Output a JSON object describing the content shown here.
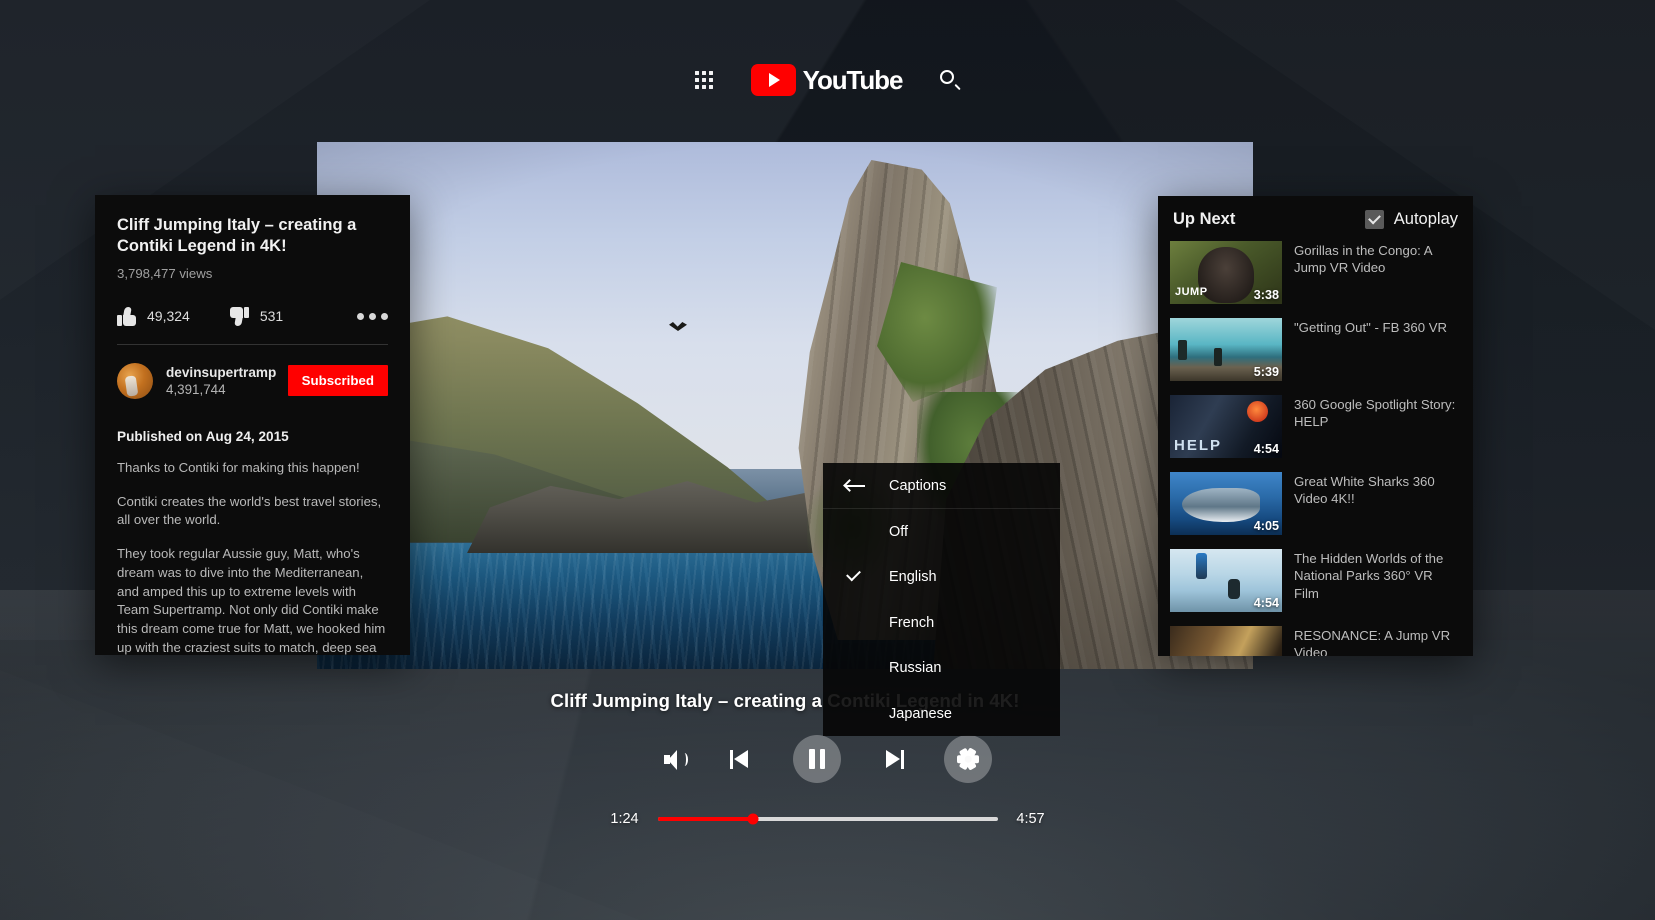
{
  "header": {
    "apps_icon": "apps-grid-icon",
    "logo_text": "YouTube",
    "search_icon": "search-icon"
  },
  "video": {
    "overlay_title": "Cliff Jumping Italy – creating a Contiki Legend in 4K!"
  },
  "info_panel": {
    "title": "Cliff Jumping Italy – creating a Contiki Legend in 4K!",
    "views": "3,798,477 views",
    "likes": "49,324",
    "dislikes": "531",
    "more_icon": "more-options-icon",
    "channel_name": "devinsupertramp",
    "channel_subs": "4,391,744",
    "subscribe_label": "Subscribed",
    "published": "Published on Aug 24, 2015",
    "description": [
      "Thanks to Contiki for making this happen!",
      "Contiki creates the world's best travel stories, all over the world.",
      "They took regular Aussie guy, Matt, who's dream was to dive into the Mediterranean, and amped this up to extreme levels with Team Supertramp. Not only did Contiki make this dream come true for Matt, we hooked him up with the craziest suits to match, deep sea base"
    ]
  },
  "up_next": {
    "heading": "Up Next",
    "autoplay_label": "Autoplay",
    "autoplay_checked": true,
    "items": [
      {
        "title": "Gorillas in the Congo: A Jump VR Video",
        "duration": "3:38",
        "art": "tb-gorilla"
      },
      {
        "title": "\"Getting Out\" - FB 360 VR",
        "duration": "5:39",
        "art": "tb-coast"
      },
      {
        "title": "360 Google Spotlight Story: HELP",
        "duration": "4:54",
        "art": "tb-help"
      },
      {
        "title": "Great White Sharks 360 Video 4K!!",
        "duration": "4:05",
        "art": "tb-shark"
      },
      {
        "title": "The Hidden Worlds of the National Parks 360° VR Film",
        "duration": "4:54",
        "art": "tb-glacier"
      },
      {
        "title": "RESONANCE: A Jump VR Video",
        "duration": "",
        "art": "tb-reso"
      }
    ]
  },
  "captions_menu": {
    "heading": "Captions",
    "back_icon": "back-arrow-icon",
    "options": [
      {
        "label": "Off",
        "selected": false
      },
      {
        "label": "English",
        "selected": true
      },
      {
        "label": "French",
        "selected": false
      },
      {
        "label": "Russian",
        "selected": false
      },
      {
        "label": "Japanese",
        "selected": false
      }
    ]
  },
  "controls": {
    "volume_icon": "volume-icon",
    "previous_icon": "previous-track-icon",
    "pause_icon": "pause-icon",
    "next_icon": "next-track-icon",
    "settings_icon": "gear-icon",
    "current_time": "1:24",
    "total_time": "4:57",
    "progress_percent": 28.2
  },
  "colors": {
    "brand_red": "#ff0000",
    "panel_bg": "#0b0b0b",
    "text_primary": "#f1f1f1",
    "text_secondary": "#b9b9b9"
  }
}
